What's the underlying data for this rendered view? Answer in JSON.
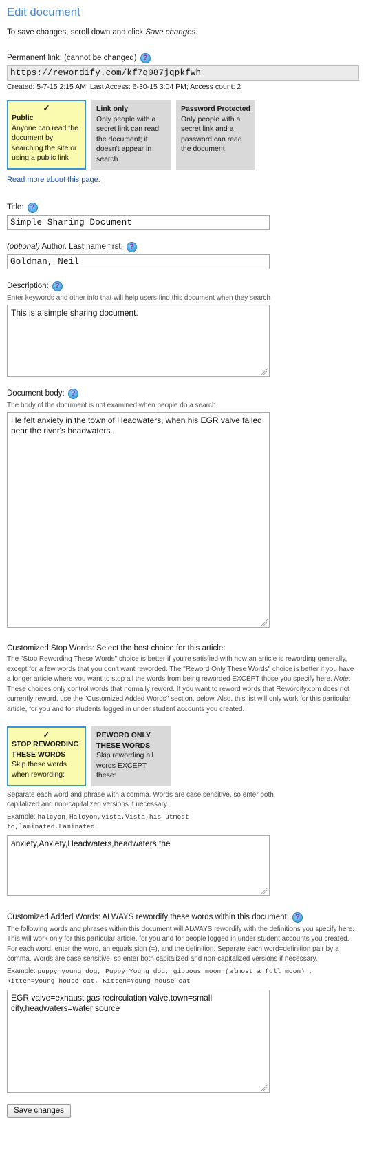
{
  "header": {
    "title": "Edit document",
    "intro_before": "To save changes, scroll down and click ",
    "intro_italic": "Save changes",
    "intro_after": "."
  },
  "permalink": {
    "label": "Permanent link: (cannot be changed)",
    "url": "https://rewordify.com/kf7q087jqpkfwh",
    "meta": "Created: 5-7-15 2:15 AM; Last Access: 6-30-15 3:04 PM; Access count: 2",
    "help_icon": "question-help-icon"
  },
  "sharing": {
    "options": [
      {
        "title": "Public",
        "desc": "Anyone can read the document by searching the site or using a public link",
        "selected": true,
        "check": "✓"
      },
      {
        "title": "Link only",
        "desc": "Only people with a secret link can read the document; it doesn't appear in search",
        "selected": false,
        "check": ""
      },
      {
        "title": "Password Protected",
        "desc": "Only people with a secret link and a password can read the document",
        "selected": false,
        "check": ""
      }
    ],
    "read_more": "Read more about this page."
  },
  "title_field": {
    "label": "Title:",
    "value": "Simple Sharing Document"
  },
  "author_field": {
    "label_italic": "(optional)",
    "label_rest": " Author. Last name first:",
    "value": "Goldman, Neil"
  },
  "description_field": {
    "label": "Description:",
    "hint": "Enter keywords and other info that will help users find this document when they search",
    "value": "This is a simple sharing document."
  },
  "body_field": {
    "label": "Document body:",
    "hint": "The body of the document is not examined when people do a search",
    "value": "He felt anxiety in the town of Headwaters, when his EGR valve failed near the river's headwaters."
  },
  "stop_words": {
    "heading": "Customized Stop Words: Select the best choice for this article:",
    "paragraph_1": "The \"Stop Rewording These Words\" choice is better if you're satisfied with how an article is rewording generally, except for a few words that you don't want reworded. The \"Reword Only These Words\" choice is better if you have a longer article where you want to stop all the words from being reworded EXCEPT those you specify here. ",
    "paragraph_note_italic": "Note",
    "paragraph_2": ": These choices only control words that normally reword. If you want to reword words that Rewordify.com does not currently reword, use the \"Customized Added Words\" section, below. Also, this list will only work for this particular article, for you and for students logged in under student accounts you created.",
    "options": [
      {
        "title": "STOP REWORDING THESE WORDS",
        "desc": "Skip these words when rewording:",
        "selected": true,
        "check": "✓"
      },
      {
        "title": "REWORD ONLY THESE WORDS",
        "desc": "Skip rewording all words EXCEPT these:",
        "selected": false,
        "check": ""
      }
    ],
    "instructions": "Separate each word and phrase with a comma. Words are case sensitive, so enter both capitalized and non-capitalized versions if necessary.",
    "example_label": "Example: ",
    "example_mono": "halcyon,Halcyon,vista,Vista,his utmost to,laminated,Laminated",
    "value": "anxiety,Anxiety,Headwaters,headwaters,the"
  },
  "added_words": {
    "heading": "Customized Added Words: ALWAYS rewordify these words within this document:",
    "paragraph": "The following words and phrases within this document will ALWAYS rewordify with the definitions you specify here. This will work only for this particular article, for you and for people logged in under student accounts you created. For each word, enter the word, an equals sign (=), and the definition. Separate each word=definition pair by a comma. Words are case sensitive, so enter both capitalized and non-capitalized versions if necessary.",
    "example_label": "Example: ",
    "example_mono": "puppy=young dog, Puppy=Young dog, gibbous moon=(almost a full moon) , kitten=young house cat, Kitten=Young house cat",
    "value": "EGR valve=exhaust gas recirculation valve,town=small city,headwaters=water source"
  },
  "footer": {
    "save_label": "Save changes"
  }
}
